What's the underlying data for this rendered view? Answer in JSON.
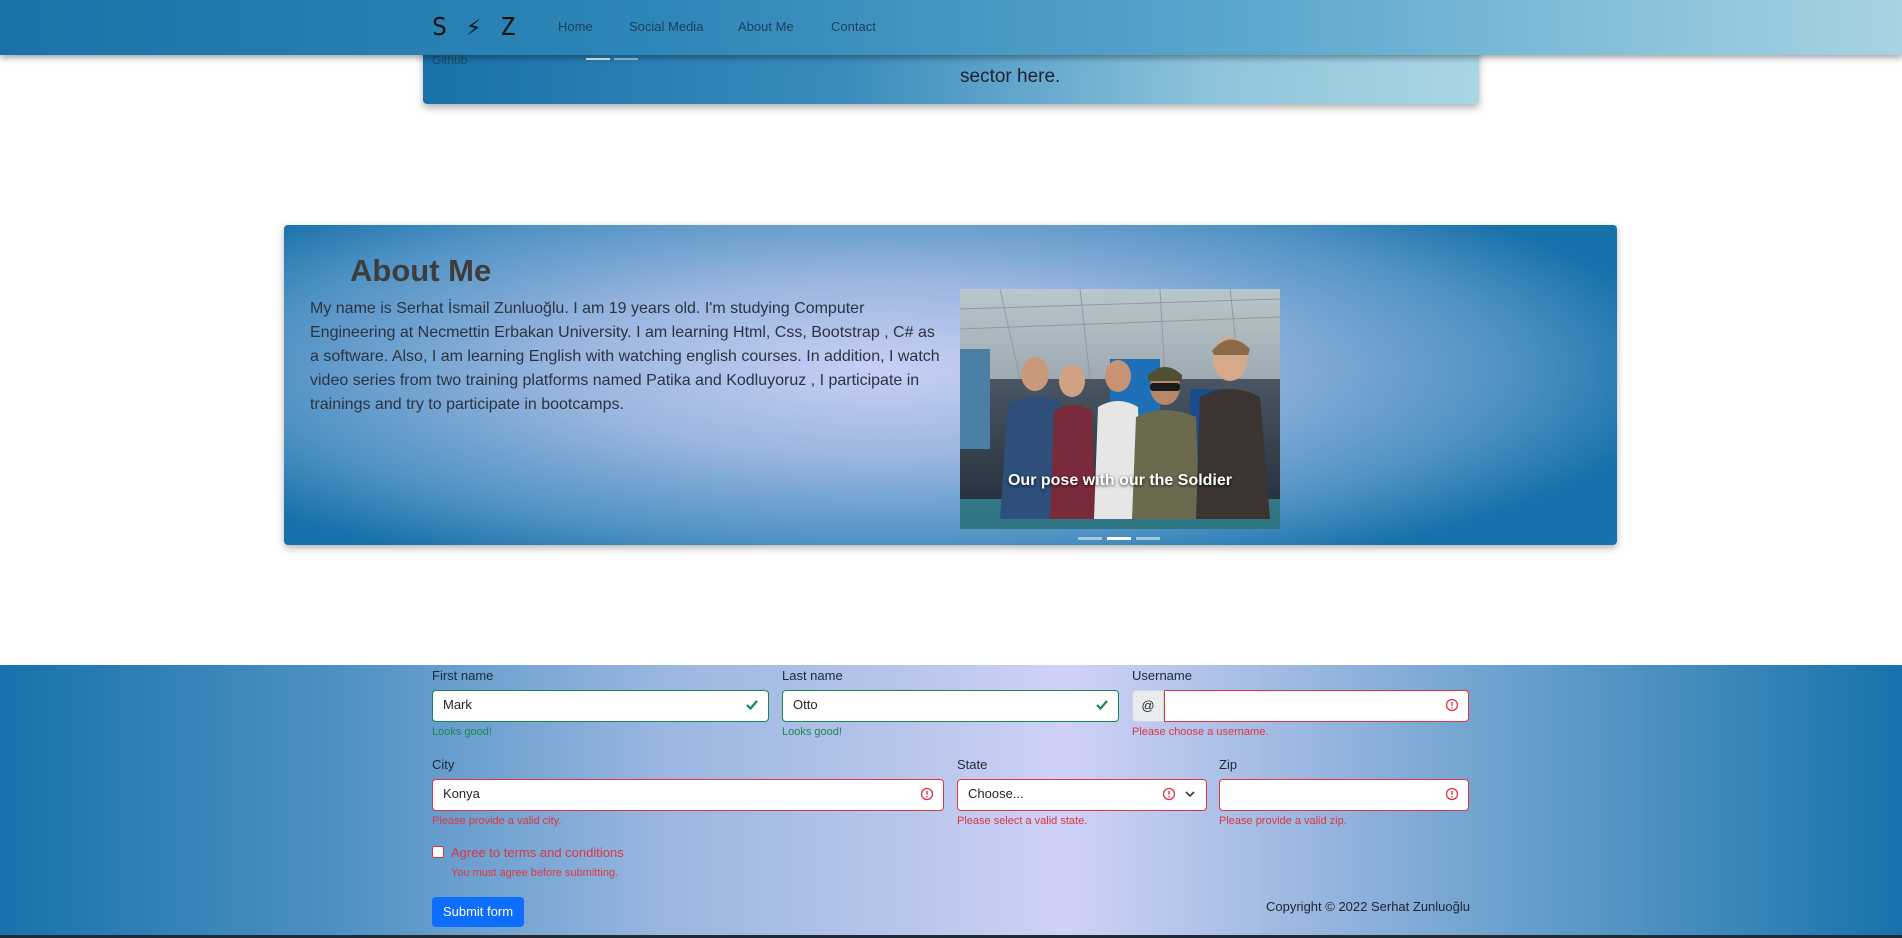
{
  "navbar": {
    "brand": "S ⚡ Z",
    "links": [
      "Home",
      "Social Media",
      "About Me",
      "Contact"
    ]
  },
  "top_card": {
    "github_label": "Github",
    "text": "sector here."
  },
  "about": {
    "title": "About Me",
    "text": "My name is Serhat İsmail Zunluoğlu. I am 19 years old. I'm studying Computer Engineering at Necmettin Erbakan University. I am learning Html, Css, Bootstrap , C# as a software. Also, I am learning English with watching english courses. In addition, I watch video series from two training platforms named Patika and Kodluyoruz , I participate in trainings and try to participate in bootcamps.",
    "carousel": {
      "caption": "Our pose with our the Soldier",
      "active_index": 1,
      "count": 3
    }
  },
  "form": {
    "first_name": {
      "label": "First name",
      "value": "Mark",
      "feedback": "Looks good!"
    },
    "last_name": {
      "label": "Last name",
      "value": "Otto",
      "feedback": "Looks good!"
    },
    "username": {
      "label": "Username",
      "prefix": "@",
      "value": "",
      "feedback": "Please choose a username."
    },
    "city": {
      "label": "City",
      "value": "Konya",
      "feedback": "Please provide a valid city."
    },
    "state": {
      "label": "State",
      "value": "Choose...",
      "feedback": "Please select a valid state."
    },
    "zip": {
      "label": "Zip",
      "value": "",
      "feedback": "Please provide a valid zip."
    },
    "terms": {
      "label": "Agree to terms and conditions",
      "feedback": "You must agree before submitting."
    },
    "submit_label": "Submit form"
  },
  "footer": {
    "copyright": "Copyright © 2022 Serhat Zunluoğlu"
  },
  "colors": {
    "valid": "#198754",
    "invalid": "#dc3545",
    "primary": "#0d6efd"
  }
}
